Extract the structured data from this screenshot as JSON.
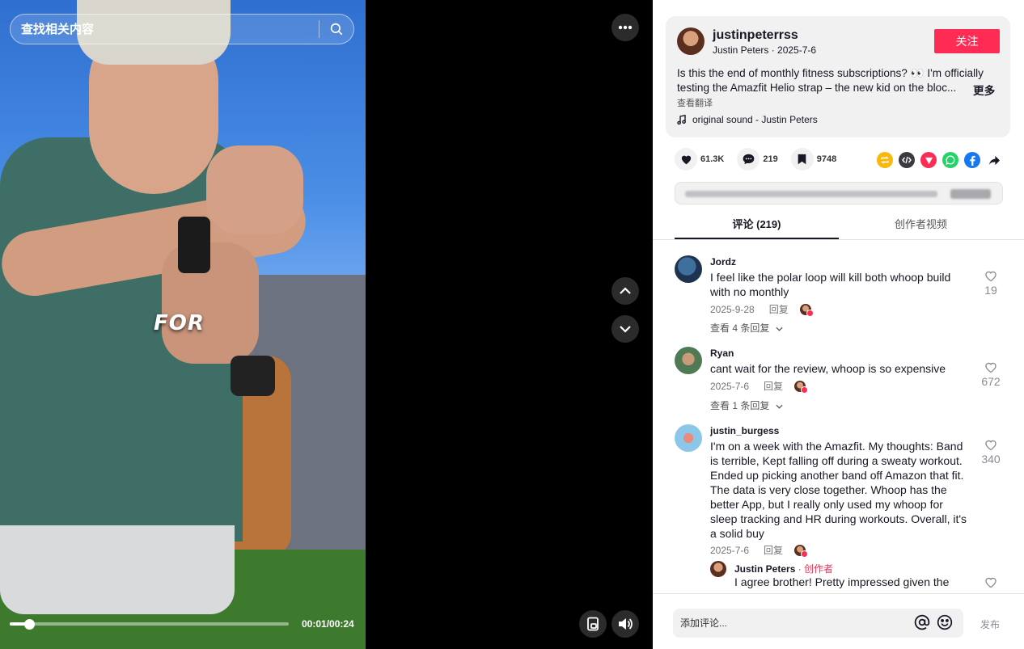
{
  "search": {
    "placeholder": "查找相关内容"
  },
  "video": {
    "caption": "FOR",
    "time": "00:01/00:24",
    "progress": 0.07
  },
  "author": {
    "handle": "justinpeterrss",
    "subline": "Justin Peters · 2025-7-6",
    "follow_label": "关注"
  },
  "description": {
    "line1": "Is this the end of monthly fitness subscriptions? 👀 I'm officially",
    "line2": "testing the Amazfit Helio strap – the new kid on the bloc...",
    "more": "更多",
    "translate": "查看翻译"
  },
  "sound": {
    "label": "original sound - Justin Peters"
  },
  "stats": {
    "likes": "61.3K",
    "comments": "219",
    "saves": "9748"
  },
  "share_icons": [
    {
      "name": "repost-icon",
      "color": "#fbb80c"
    },
    {
      "name": "embed-icon",
      "color": "#3b3b3f"
    },
    {
      "name": "send-to-friends-icon",
      "color": "#fe2c55"
    },
    {
      "name": "whatsapp-icon",
      "color": "#25d366"
    },
    {
      "name": "facebook-icon",
      "color": "#1877f2"
    },
    {
      "name": "share-arrow-icon",
      "color": "#161823"
    }
  ],
  "tabs": {
    "comments": "评论 (219)",
    "creator_videos": "创作者视频"
  },
  "comments": [
    {
      "name": "Jordz",
      "text": "I feel like the polar loop will kill both whoop build with no monthly",
      "date": "2025-9-28",
      "reply_label": "回复",
      "likes": "19",
      "view_replies": "查看 4 条回复"
    },
    {
      "name": "Ryan",
      "text": "cant wait for the review, whoop is so expensive",
      "date": "2025-7-6",
      "reply_label": "回复",
      "likes": "672",
      "view_replies": "查看 1 条回复"
    },
    {
      "name": "justin_burgess",
      "text": "I'm on a week with the Amazfit. My thoughts: Band is terrible, Kept falling off during a sweaty workout. Ended up picking another band off Amazon that fit. The data is very close together. Whoop has the better App, but I really only used my whoop for sleep tracking and HR during workouts. Overall, it's a solid buy",
      "date": "2025-7-6",
      "reply_label": "回复",
      "likes": "340"
    }
  ],
  "reply": {
    "name": "Justin Peters",
    "separator": " · ",
    "creator_badge": "创作者",
    "text": "I agree brother! Pretty impressed given the"
  },
  "composer": {
    "placeholder": "添加评论...",
    "post_label": "发布"
  }
}
